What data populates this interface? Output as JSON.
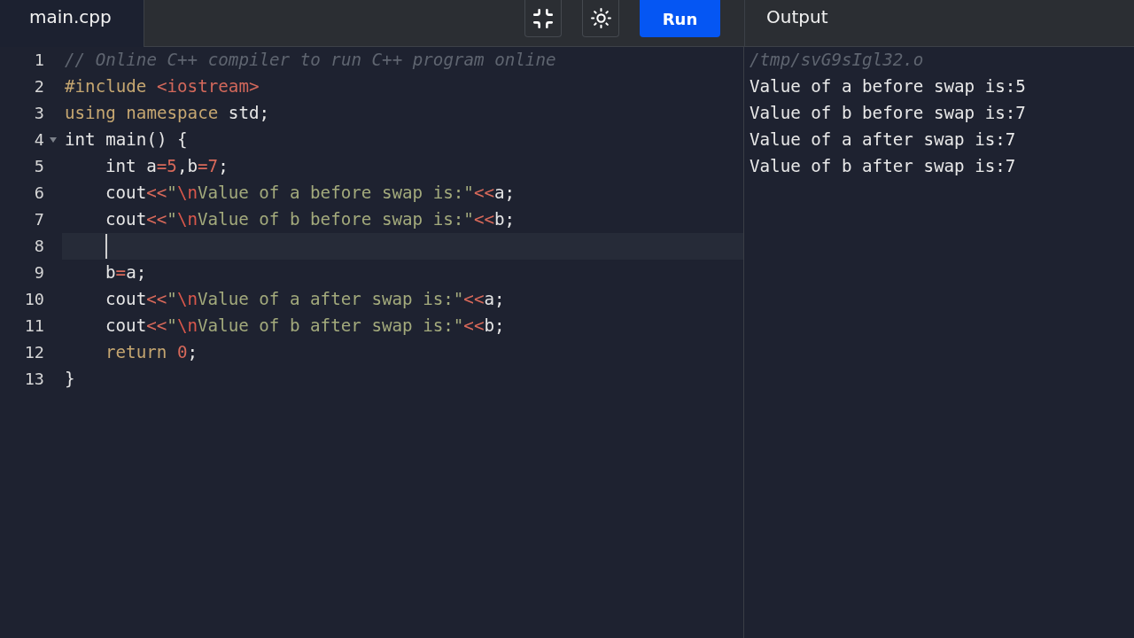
{
  "editor_tab": {
    "label": "main.cpp",
    "selected": true
  },
  "toolbar": {
    "buttons": [
      {
        "kind": "minimize"
      },
      {
        "kind": "theme"
      },
      {
        "kind": "run",
        "label": "Run"
      }
    ]
  },
  "editor": {
    "lines": [
      {
        "number": "1",
        "current": false,
        "tokens": [
          {
            "kind": "comment",
            "text": "// Online C++ compiler to run C++ program online"
          }
        ]
      },
      {
        "number": "2",
        "current": false,
        "tokens": [
          {
            "kind": "keyword",
            "text": "#include "
          },
          {
            "kind": "header",
            "text": "<iostream>"
          }
        ]
      },
      {
        "number": "3",
        "current": false,
        "tokens": [
          {
            "kind": "keyword",
            "text": "using namespace "
          },
          {
            "kind": "plain",
            "text": "std;"
          }
        ]
      },
      {
        "number": "4",
        "current": false,
        "expanded": true,
        "tokens": [
          {
            "kind": "plain",
            "text": "int main() {"
          }
        ],
        "children": [
          {
            "number": "5",
            "current": false,
            "tokens": [
              {
                "kind": "plain",
                "text": "int a"
              },
              {
                "kind": "operator",
                "text": "="
              },
              {
                "kind": "number",
                "text": "5"
              },
              {
                "kind": "plain",
                "text": ",b"
              },
              {
                "kind": "operator",
                "text": "="
              },
              {
                "kind": "number",
                "text": "7"
              },
              {
                "kind": "plain",
                "text": ";"
              }
            ]
          },
          {
            "number": "6",
            "current": false,
            "tokens": [
              {
                "kind": "plain",
                "text": "cout"
              },
              {
                "kind": "operator",
                "text": "<<"
              },
              {
                "kind": "string",
                "text": "\""
              },
              {
                "kind": "escape",
                "text": "\\n"
              },
              {
                "kind": "string",
                "text": "Value of a before swap is:\""
              },
              {
                "kind": "operator",
                "text": "<<"
              },
              {
                "kind": "plain",
                "text": "a;"
              }
            ]
          },
          {
            "number": "7",
            "current": false,
            "tokens": [
              {
                "kind": "plain",
                "text": "cout"
              },
              {
                "kind": "operator",
                "text": "<<"
              },
              {
                "kind": "string",
                "text": "\""
              },
              {
                "kind": "escape",
                "text": "\\n"
              },
              {
                "kind": "string",
                "text": "Value of b before swap is:\""
              },
              {
                "kind": "operator",
                "text": "<<"
              },
              {
                "kind": "plain",
                "text": "b;"
              }
            ]
          },
          {
            "number": "8",
            "current": true
          },
          {
            "number": "9",
            "current": false,
            "tokens": [
              {
                "kind": "plain",
                "text": "b"
              },
              {
                "kind": "operator",
                "text": "="
              },
              {
                "kind": "plain",
                "text": "a;"
              }
            ]
          },
          {
            "number": "10",
            "current": false,
            "tokens": [
              {
                "kind": "plain",
                "text": "cout"
              },
              {
                "kind": "operator",
                "text": "<<"
              },
              {
                "kind": "string",
                "text": "\""
              },
              {
                "kind": "escape",
                "text": "\\n"
              },
              {
                "kind": "string",
                "text": "Value of a after swap is:\""
              },
              {
                "kind": "operator",
                "text": "<<"
              },
              {
                "kind": "plain",
                "text": "a;"
              }
            ]
          },
          {
            "number": "11",
            "current": false,
            "tokens": [
              {
                "kind": "plain",
                "text": "cout"
              },
              {
                "kind": "operator",
                "text": "<<"
              },
              {
                "kind": "string",
                "text": "\""
              },
              {
                "kind": "escape",
                "text": "\\n"
              },
              {
                "kind": "string",
                "text": "Value of b after swap is:\""
              },
              {
                "kind": "operator",
                "text": "<<"
              },
              {
                "kind": "plain",
                "text": "b;"
              }
            ]
          },
          {
            "number": "12",
            "current": false,
            "tokens": [
              {
                "kind": "keyword",
                "text": "return "
              },
              {
                "kind": "number",
                "text": "0"
              },
              {
                "kind": "plain",
                "text": ";"
              }
            ]
          }
        ]
      },
      {
        "number": "13",
        "current": false,
        "tokens": [
          {
            "kind": "plain",
            "text": "}"
          }
        ]
      }
    ]
  },
  "output": {
    "title": "Output",
    "path": "/tmp/svG9sIgl32.o",
    "lines": [
      "Value of a before swap is:5",
      "Value of b before swap is:7",
      "Value of a after swap is:7",
      "Value of b after swap is:7"
    ]
  }
}
